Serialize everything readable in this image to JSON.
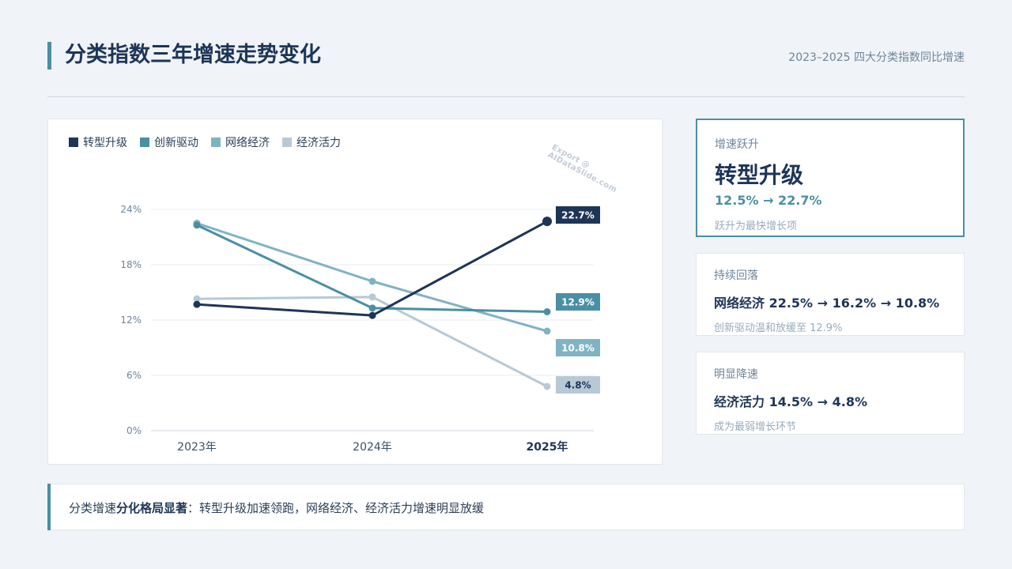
{
  "header": {
    "title": "分类指数三年增速走势变化",
    "subtitle": "2023–2025 四大分类指数同比增速"
  },
  "watermark": "Export @ AIDataSlide.com",
  "chart_data": {
    "type": "line",
    "categories": [
      "2023年",
      "2024年",
      "2025年"
    ],
    "highlight_category": "2025年",
    "yticks": [
      "0%",
      "6%",
      "12%",
      "18%",
      "24%"
    ],
    "ylim": [
      0,
      24
    ],
    "grid": true,
    "legend_position": "top-left",
    "series": [
      {
        "name": "转型升级",
        "color": "#1d3557",
        "values": [
          13.7,
          12.5,
          22.7
        ],
        "end_label": "22.7%"
      },
      {
        "name": "创新驱动",
        "color": "#4a8fa3",
        "values": [
          22.3,
          13.3,
          12.9
        ],
        "end_label": "12.9%"
      },
      {
        "name": "网络经济",
        "color": "#7fb3c4",
        "values": [
          22.5,
          16.2,
          10.8
        ],
        "end_label": "10.8%"
      },
      {
        "name": "经济活力",
        "color": "#b8c9d6",
        "values": [
          14.3,
          14.5,
          4.8
        ],
        "end_label": "4.8%"
      }
    ]
  },
  "cards": [
    {
      "label": "增速跃升",
      "big": "转型升级",
      "accent": "12.5% → 22.7%",
      "note": "跃升为最快增长项"
    },
    {
      "label": "持续回落",
      "main": "网络经济 22.5% → 16.2% → 10.8%",
      "note": "创新驱动温和放缓至 12.9%"
    },
    {
      "label": "明显降速",
      "main": "经济活力 14.5% → 4.8%",
      "note": "成为最弱增长环节"
    }
  ],
  "bottom": {
    "prefix": "分类增速",
    "bold": "分化格局显著",
    "suffix": "：转型升级加速领跑，网络经济、经济活力增速明显放缓"
  }
}
